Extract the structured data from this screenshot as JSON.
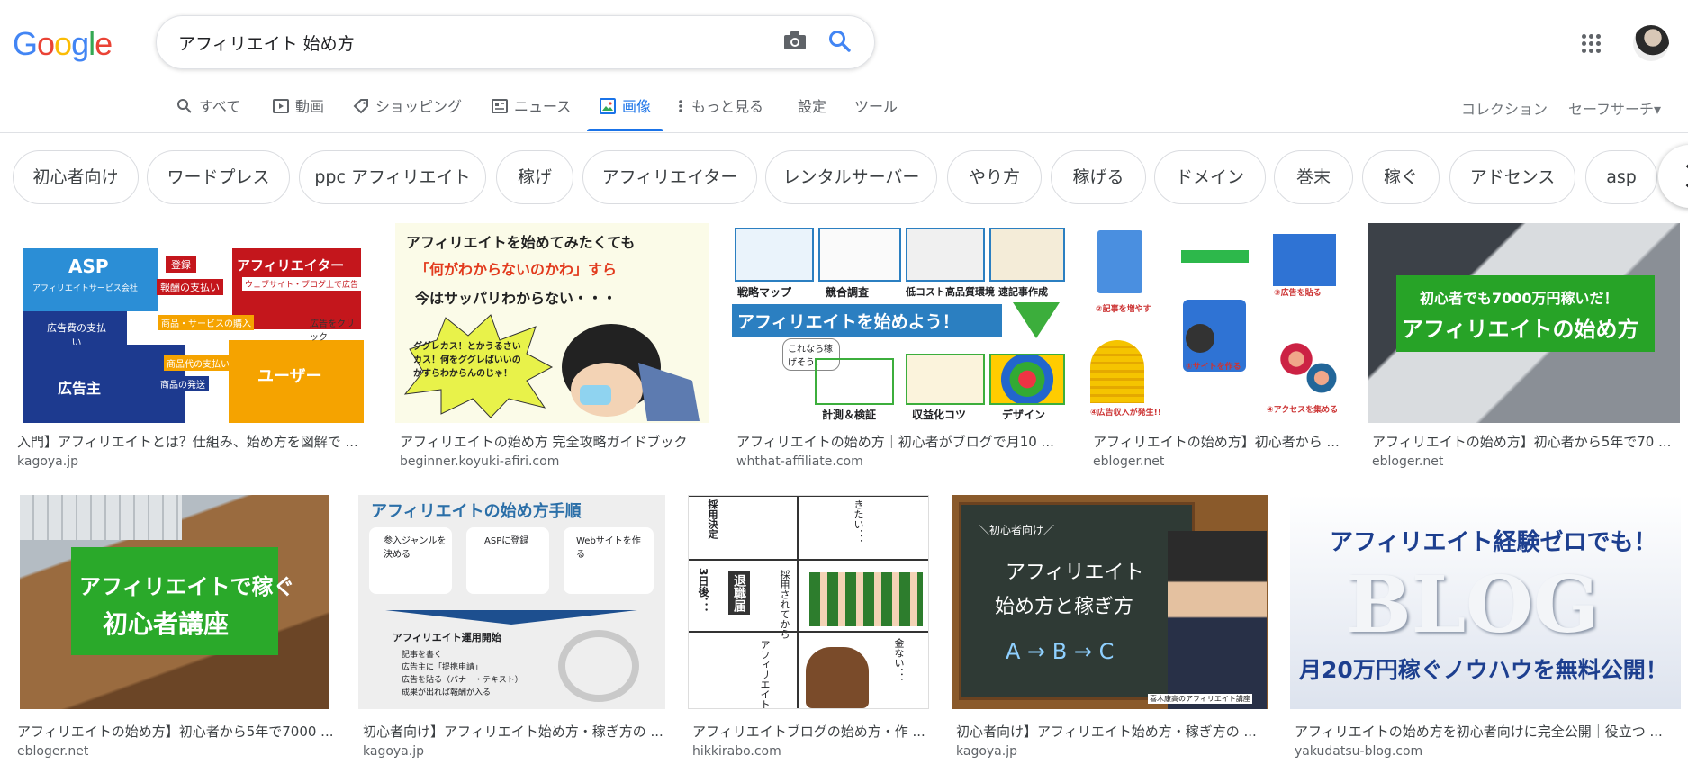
{
  "logo": {
    "letters": [
      "G",
      "o",
      "o",
      "g",
      "l",
      "e"
    ],
    "colors": [
      "#4285f4",
      "#ea4335",
      "#fbbc05",
      "#4285f4",
      "#34a853",
      "#ea4335"
    ]
  },
  "search": {
    "query": "アフィリエイト 始め方"
  },
  "tabs": [
    {
      "label": "すべて",
      "icon": "search-icon"
    },
    {
      "label": "動画",
      "icon": "play-icon"
    },
    {
      "label": "ショッピング",
      "icon": "tag-icon"
    },
    {
      "label": "ニュース",
      "icon": "news-icon"
    },
    {
      "label": "画像",
      "icon": "image-icon",
      "active": true
    },
    {
      "label": "もっと見る",
      "icon": "more-vert-icon"
    },
    {
      "label": "設定"
    },
    {
      "label": "ツール"
    }
  ],
  "right_tools": {
    "collection": "コレクション",
    "safesearch": "セーフサーチ▾"
  },
  "chips": [
    "初心者向け",
    "ワードプレス",
    "ppc アフィリエイト",
    "稼げ",
    "アフィリエイター",
    "レンタルサーバー",
    "やり方",
    "稼げる",
    "ドメイン",
    "巻末",
    "稼ぐ",
    "アドセンス",
    "asp"
  ],
  "results_row1": [
    {
      "title": "入門】アフィリエイトとは？仕組み、始め方を図解で ...",
      "site": "kagoya.jp"
    },
    {
      "title": "アフィリエイトの始め方 完全攻略ガイドブック",
      "site": "beginner.koyuki-afiri.com"
    },
    {
      "title": "アフィリエイトの始め方｜初心者がブログで月10 ...",
      "site": "whthat-affiliate.com"
    },
    {
      "title": "アフィリエイトの始め方】初心者から ...",
      "site": "ebloger.net"
    },
    {
      "title": "アフィリエイトの始め方】初心者から5年で70 ...",
      "site": "ebloger.net"
    }
  ],
  "results_row2": [
    {
      "title": "アフィリエイトの始め方】初心者から5年で7000 ...",
      "site": "ebloger.net"
    },
    {
      "title": "初心者向け】アフィリエイト始め方・稼ぎ方の ...",
      "site": "kagoya.jp"
    },
    {
      "title": "アフィリエイトブログの始め方・作 ...",
      "site": "hikkirabo.com"
    },
    {
      "title": "初心者向け】アフィリエイト始め方・稼ぎ方の ...",
      "site": "kagoya.jp"
    },
    {
      "title": "アフィリエイトの始め方を初心者向けに完全公開｜役立つ ...",
      "site": "yakudatsu-blog.com"
    }
  ],
  "img_text": {
    "r1c1": {
      "asp": "ASP",
      "asp_sub": "アフィリエイトサービス会社",
      "affiliater": "アフィリエイター",
      "affiliater_sub": "ウェブサイト・ブログ上で広告",
      "register": "登録",
      "reward": "報酬の支払い",
      "ad_fee": "広告費の支払い",
      "service_buy": "商品・サービスの購入",
      "click": "広告をクリック",
      "price_pay": "商品代の支払い",
      "shipping": "商品の発送",
      "advertiser": "広告主",
      "user": "ユーザー"
    },
    "r1c2": {
      "line1": "アフィリエイトを始めてみたくても",
      "line2": "「何がわからないのかわ」すら",
      "line3": "今はサッパリわからない・・・",
      "burst": "ググレカス！とかうるさいカス！何をググレばいいのかすらわからんのじゃ！"
    },
    "r1c3": {
      "t1": "戦略マップ",
      "t2": "競合調査",
      "t3": "低コスト高品質環境",
      "t4": "速記事作成",
      "banner": "アフィリエイトを始めよう！",
      "bubble": "これなら稼げそう！",
      "b1": "計測＆検証",
      "b2": "収益化コツ",
      "b3": "デザイン"
    },
    "r1c4": {
      "s1": "②記事を増やす",
      "s2": "③広告を貼る",
      "s3": "①サイトを作る",
      "s4": "④アクセスを集める",
      "s5": "④広告収入が発生!!"
    },
    "r1c5": {
      "line1": "初心者でも7000万円稼いだ！",
      "line2": "アフィリエイトの始め方"
    },
    "r2c1": {
      "line1": "アフィリエイトで稼ぐ",
      "line2": "初心者講座"
    },
    "r2c2": {
      "title": "アフィリエイトの始め方手順",
      "s1": "参入ジャンルを決める",
      "s2": "ASPに登録",
      "s3": "Webサイトを作る",
      "s4": "アフィリエイト運用開始",
      "l1": "記事を書く",
      "l2": "広告主に「提携申請」",
      "l3": "広告を貼る（バナー・テキスト）",
      "l4": "成果が出れば報酬が入る"
    },
    "r2c3": {
      "t1": "採用決定",
      "t2": "3日後．．．",
      "t3": "退職届",
      "t4": "採用されてから",
      "t5": "アフィリエイト始めよう．．．",
      "t6": "金ない．．．",
      "t7": "きたい．．．"
    },
    "r2c4": {
      "small": "＼初心者向け／",
      "line1": "アフィリエイト",
      "line2": "始め方と稼ぎ方",
      "line3": "A → B → C",
      "credit": "喜木康高のアフィリエイト講座"
    },
    "r2c5": {
      "line1": "アフィリエイト経験ゼロでも！",
      "big": "BLOG",
      "line2": "月20万円稼ぐノウハウを無料公開！"
    }
  }
}
